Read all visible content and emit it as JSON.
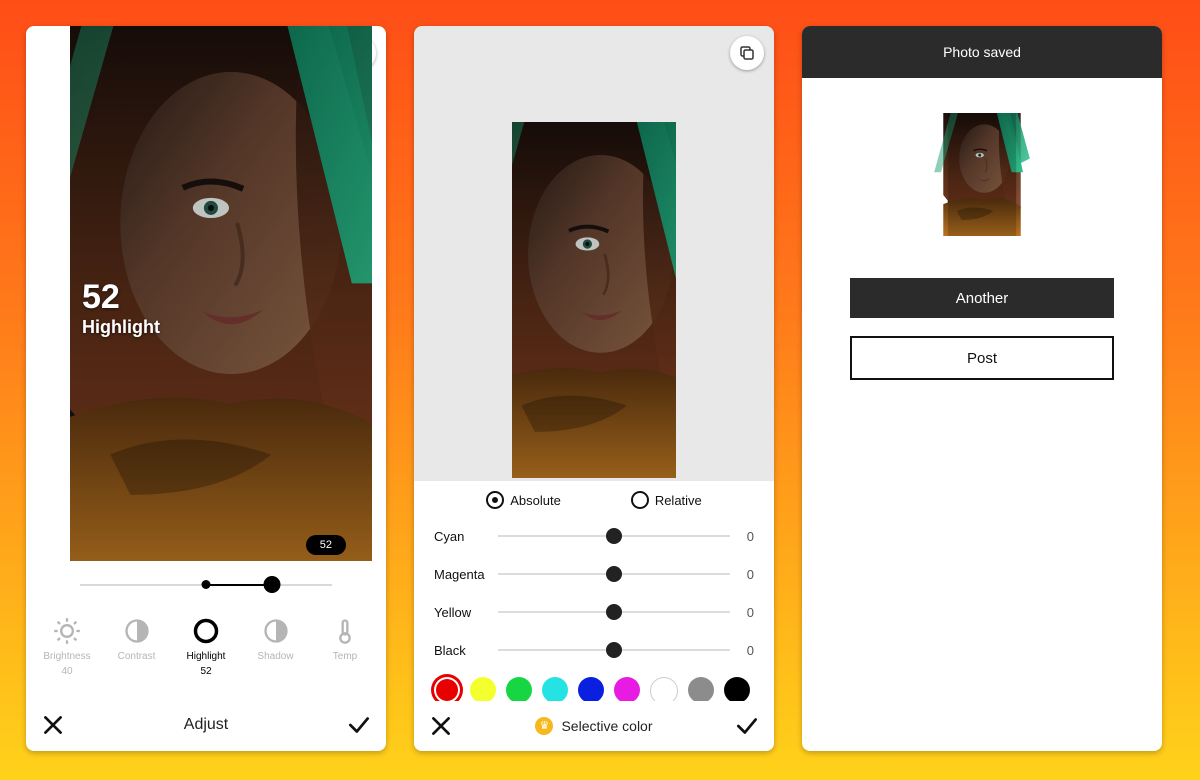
{
  "screen1": {
    "overlay_value": "52",
    "overlay_label": "Highlight",
    "bubble": "52",
    "tools": [
      {
        "label": "Brightness",
        "value": "40"
      },
      {
        "label": "Contrast",
        "value": ""
      },
      {
        "label": "Highlight",
        "value": "52"
      },
      {
        "label": "Shadow",
        "value": ""
      },
      {
        "label": "Temp",
        "value": ""
      }
    ],
    "bottom_label": "Adjust"
  },
  "screen2": {
    "mode_absolute": "Absolute",
    "mode_relative": "Relative",
    "sliders": [
      {
        "name": "Cyan",
        "value": "0"
      },
      {
        "name": "Magenta",
        "value": "0"
      },
      {
        "name": "Yellow",
        "value": "0"
      },
      {
        "name": "Black",
        "value": "0"
      }
    ],
    "swatches": [
      "#e80000",
      "#f4ff2e",
      "#17d643",
      "#25e3e3",
      "#0a1fe0",
      "#e81be3",
      "#ffffff",
      "#8c8c8c",
      "#000000"
    ],
    "bottom_label": "Selective color"
  },
  "screen3": {
    "title": "Photo saved",
    "another": "Another",
    "post": "Post"
  }
}
